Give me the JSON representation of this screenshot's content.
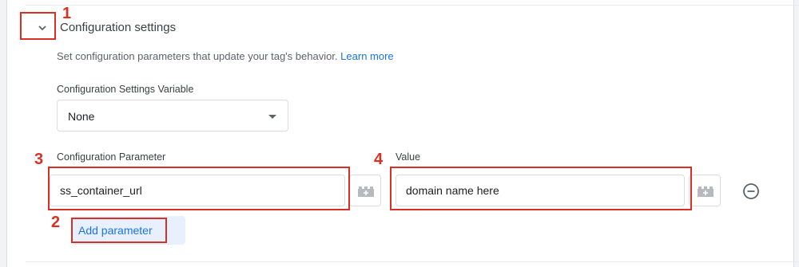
{
  "section": {
    "title": "Configuration settings",
    "description": "Set configuration parameters that update your tag's behavior.",
    "learn_more": "Learn more"
  },
  "settings_variable": {
    "label": "Configuration Settings Variable",
    "value": "None"
  },
  "parameter": {
    "label": "Configuration Parameter",
    "value": "ss_container_url"
  },
  "value_field": {
    "label": "Value",
    "value": "domain name here"
  },
  "add_parameter_label": "Add parameter",
  "annotations": [
    "1",
    "2",
    "3",
    "4"
  ],
  "colors": {
    "annotation_red": "#d93025",
    "link_blue": "#1a73e8",
    "button_bg": "#e8f0fe"
  },
  "icons": [
    "chevron-down-icon",
    "variable-picker-icon",
    "remove-circle-icon"
  ]
}
